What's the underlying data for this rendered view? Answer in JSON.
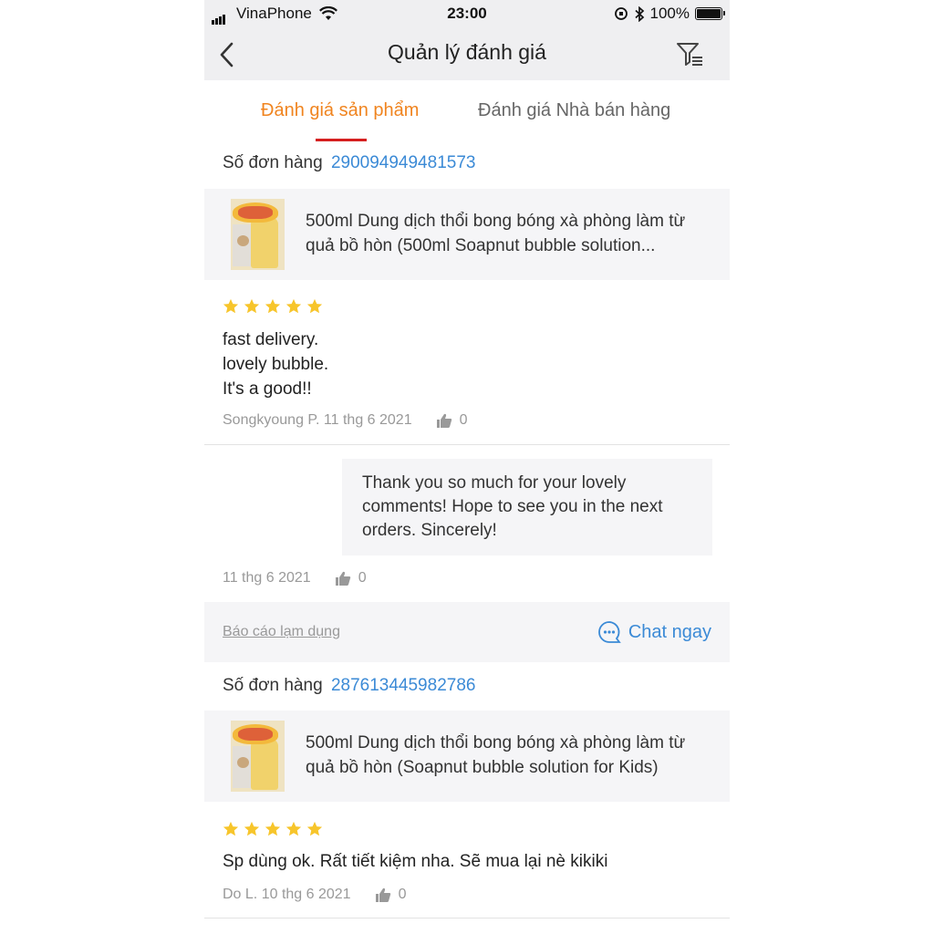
{
  "status_bar": {
    "carrier": "VinaPhone",
    "time": "23:00",
    "battery": "100%"
  },
  "header": {
    "title": "Quản lý đánh giá"
  },
  "tabs": [
    {
      "label": "Đánh giá sản phẩm",
      "active": true
    },
    {
      "label": "Đánh giá Nhà bán hàng",
      "active": false
    }
  ],
  "reviews": [
    {
      "order_label": "Số đơn hàng",
      "order_number": "290094949481573",
      "product_title": "500ml Dung dịch thổi bong bóng xà phòng làm từ quả bồ hòn (500ml Soapnut bubble solution...",
      "rating": 5,
      "comment": "fast delivery.\nlovely bubble.\nIt's a good!!",
      "author": "Songkyoung P.",
      "date": "11 thg 6 2021",
      "likes": "0",
      "reply": {
        "text": "Thank you so much for your lovely comments! Hope to see you in the next orders. Sincerely!",
        "date": "11 thg 6 2021",
        "likes": "0"
      },
      "report_label": "Báo cáo lạm dụng",
      "chat_label": "Chat ngay"
    },
    {
      "order_label": "Số đơn hàng",
      "order_number": "287613445982786",
      "product_title": "500ml Dung dịch thổi bong bóng xà phòng làm từ quả bồ hòn (Soapnut bubble solution for Kids)",
      "rating": 5,
      "comment": "Sp dùng ok. Rất tiết kiệm nha. Sẽ mua lại nè kikiki",
      "author": "Do L.",
      "date": "10 thg 6 2021",
      "likes": "0"
    }
  ],
  "colors": {
    "accent_orange": "#f0841f",
    "link_blue": "#3b8ad6",
    "underline_red": "#d51f1f",
    "star_yellow": "#f7c52b"
  }
}
